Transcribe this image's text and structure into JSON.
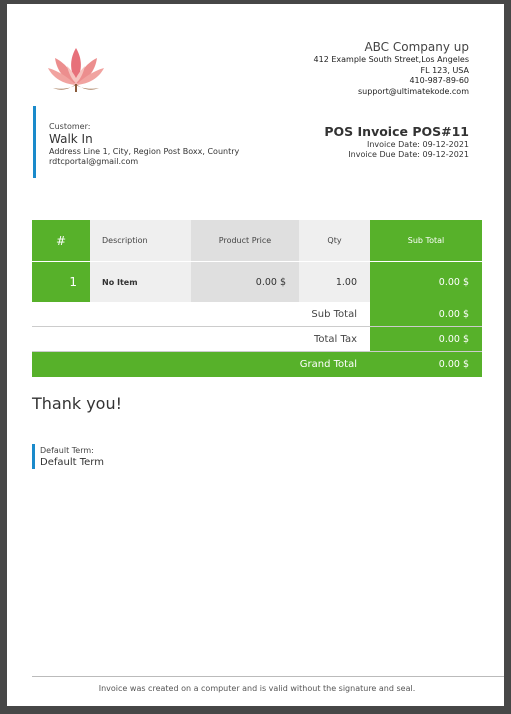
{
  "company": {
    "name": "ABC Company up",
    "address_line1": "412 Example South Street,Los Angeles",
    "address_line2": "FL 123, USA",
    "phone": "410-987-89-60",
    "email": "support@ultimatekode.com"
  },
  "customer": {
    "label": "Customer:",
    "name": "Walk In",
    "address": "Address Line 1, City, Region Post Boxx, Country",
    "email": "rdtcportal@gmail.com"
  },
  "invoice": {
    "title": "POS Invoice POS#11",
    "date": "Invoice Date: 09-12-2021",
    "due_date": "Invoice Due Date: 09-12-2021"
  },
  "table": {
    "headers": [
      "#",
      "Description",
      "Product Price",
      "Qty",
      "Sub Total"
    ],
    "rows": [
      {
        "num": "1",
        "description": "No Item",
        "price": "0.00 $",
        "qty": "1.00",
        "subtotal": "0.00 $"
      }
    ]
  },
  "totals": {
    "sub_total_label": "Sub Total",
    "sub_total": "0.00 $",
    "total_tax_label": "Total Tax",
    "total_tax": "0.00 $",
    "grand_total_label": "Grand Total",
    "grand_total": "0.00 $"
  },
  "thanks": "Thank you!",
  "term": {
    "label": "Default Term:",
    "value": "Default Term"
  },
  "footer": "Invoice was created on a computer and is valid without the signature and seal.",
  "colors": {
    "accent_green": "#57b12a",
    "accent_blue": "#1a8acb"
  }
}
